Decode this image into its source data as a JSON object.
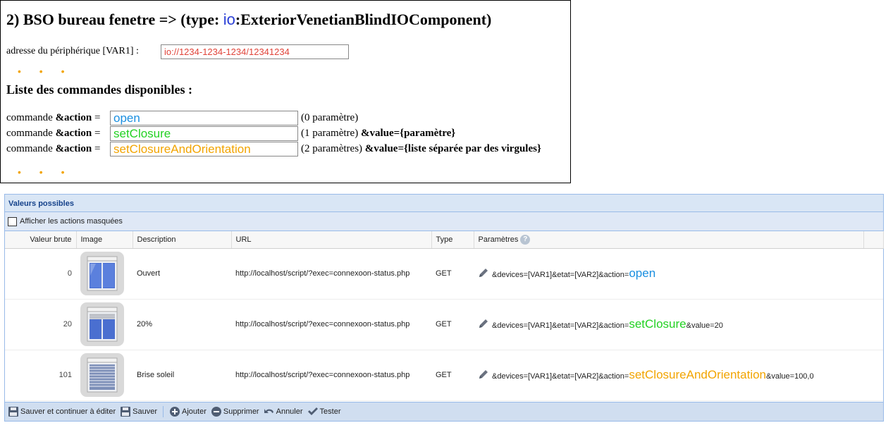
{
  "help": {
    "title_prefix": "2) BSO bureau fenetre => (type: ",
    "title_io": "io",
    "title_suffix": ":ExteriorVenetianBlindIOComponent)",
    "address_label": "adresse du périphérique [VAR1] :",
    "address_value": "io://1234-1234-1234/12341234",
    "dots": "• • •",
    "list_title": "Liste des commandes disponibles :",
    "cmd_label_prefix": "commande ",
    "cmd_label_bold": "&action",
    "cmd_label_suffix": " =",
    "commands": [
      {
        "value": "open",
        "note_plain": "(0 paramètre)",
        "note_bold": "",
        "color": "#1a8fe0"
      },
      {
        "value": "setClosure",
        "note_plain": "(1 paramètre) ",
        "note_bold": "&value={paramètre}",
        "color": "#23d123"
      },
      {
        "value": "setClosureAndOrientation",
        "note_plain": "(2 paramètres) ",
        "note_bold": "&value={liste séparée par des virgules}",
        "color": "#f2a400"
      }
    ]
  },
  "panel": {
    "title": "Valeurs possibles",
    "show_hidden_label": "Afficher les actions masquées",
    "columns": [
      "Valeur brute",
      "Image",
      "Description",
      "URL",
      "Type",
      "Paramètres"
    ],
    "help_glyph": "?",
    "rows": [
      {
        "raw": "0",
        "description": "Ouvert",
        "url": "http://localhost/script/?exec=connexoon-status.php",
        "type": "GET",
        "params_prefix": "&devices=[VAR1]&etat=[VAR2]&action=",
        "params_cmd": "open",
        "params_suffix": "",
        "image": "window-open-icon"
      },
      {
        "raw": "20",
        "description": "20%",
        "url": "http://localhost/script/?exec=connexoon-status.php",
        "type": "GET",
        "params_prefix": "&devices=[VAR1]&etat=[VAR2]&action=",
        "params_cmd": "setClosure",
        "params_suffix": "&value=20",
        "image": "window-blind-20-icon"
      },
      {
        "raw": "101",
        "description": "Brise soleil",
        "url": "http://localhost/script/?exec=connexoon-status.php",
        "type": "GET",
        "params_prefix": "&devices=[VAR1]&etat=[VAR2]&action=",
        "params_cmd": "setClosureAndOrientation",
        "params_suffix": "&value=100,0",
        "image": "window-blind-slats-icon"
      }
    ],
    "toolbar": {
      "save_continue": "Sauver et continuer à éditer",
      "save": "Sauver",
      "add": "Ajouter",
      "delete": "Supprimer",
      "cancel": "Annuler",
      "test": "Tester"
    }
  },
  "colors": {
    "open": "#1a8fe0",
    "setClosure": "#23d123",
    "setClosureAndOrientation": "#f2a400",
    "address": "#e0443a",
    "io": "#2a3fd6",
    "panel_header": "#15428b"
  }
}
